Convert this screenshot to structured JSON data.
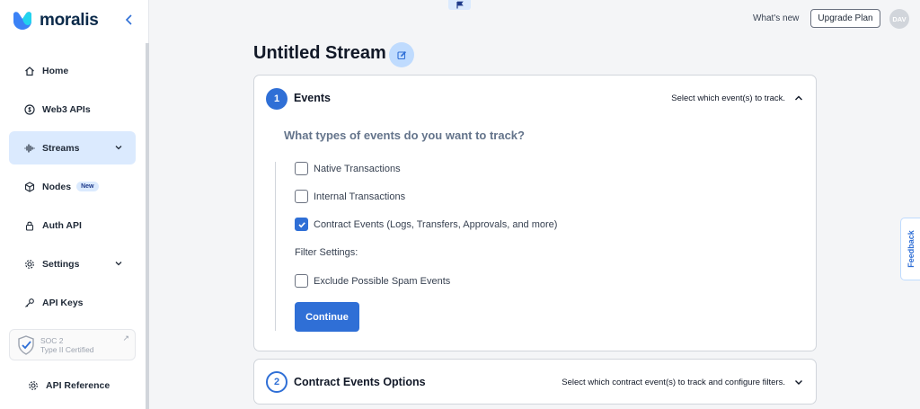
{
  "brand": {
    "name": "moralis",
    "color": "#2f6fd6"
  },
  "sidebar": {
    "items": [
      {
        "label": "Home",
        "icon": "home-icon"
      },
      {
        "label": "Web3 APIs",
        "icon": "dollar-icon"
      },
      {
        "label": "Streams",
        "icon": "waveform-icon",
        "active": true,
        "expandable": true
      },
      {
        "label": "Nodes",
        "icon": "cube-icon",
        "badge": "New"
      },
      {
        "label": "Auth API",
        "icon": "lock-icon"
      },
      {
        "label": "Settings",
        "icon": "gear-icon",
        "expandable": true
      },
      {
        "label": "API Keys",
        "icon": "key-icon"
      }
    ],
    "soc": {
      "line1": "SOC 2",
      "line2": "Type II Certified"
    },
    "api_reference": "API Reference"
  },
  "topbar": {
    "whats_new": "What's new",
    "upgrade": "Upgrade Plan",
    "avatar": "DAV"
  },
  "main": {
    "title": "Untitled Stream",
    "events_card": {
      "step": "1",
      "title": "Events",
      "hint": "Select which event(s) to track.",
      "question": "What types of events do you want to track?",
      "options": [
        {
          "label": "Native Transactions",
          "checked": false
        },
        {
          "label": "Internal Transactions",
          "checked": false
        },
        {
          "label": "Contract Events (Logs, Transfers, Approvals, and more)",
          "checked": true
        }
      ],
      "filter_label": "Filter Settings:",
      "filter_option": {
        "label": "Exclude Possible Spam Events",
        "checked": false
      },
      "continue": "Continue"
    },
    "contract_card": {
      "step": "2",
      "title": "Contract Events Options",
      "hint": "Select which contract event(s) to track and configure filters."
    }
  },
  "feedback": "Feedback"
}
